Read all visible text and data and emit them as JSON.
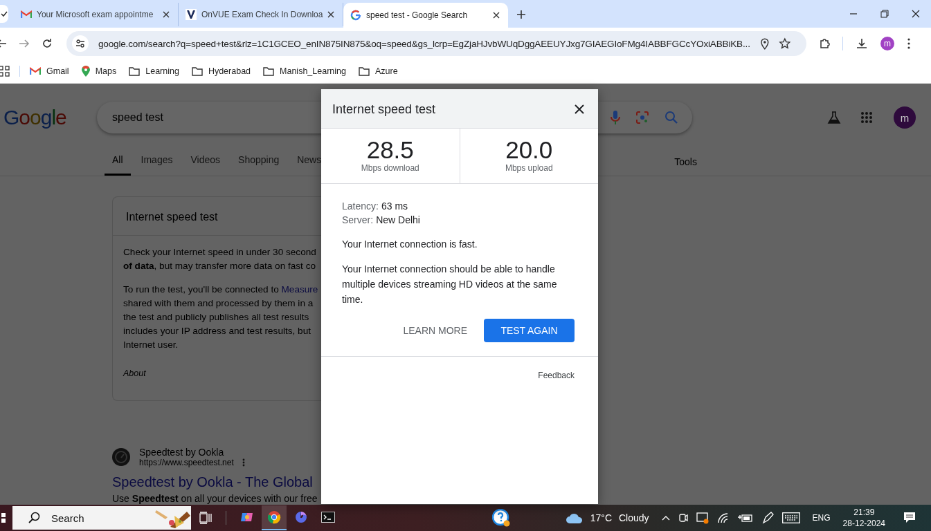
{
  "browser": {
    "tabs": [
      {
        "title": "Your Microsoft exam appointme",
        "kind": "gmail",
        "selected": false
      },
      {
        "title": "OnVUE Exam Check In Downloa",
        "kind": "vue",
        "selected": false
      },
      {
        "title": "speed test - Google Search",
        "kind": "google",
        "selected": true
      }
    ],
    "address": "google.com/search?q=speed+test&rlz=1C1GCEO_enIN875IN875&oq=speed&gs_lcrp=EgZjaHJvbWUqDggAEEUYJxg7GIAEGIoFMg4IABBFGCcYOxiABBiKB...",
    "avatar": "m",
    "bookmarks": [
      {
        "label": "Gmail",
        "kind": "gmail"
      },
      {
        "label": "Maps",
        "kind": "maps"
      },
      {
        "label": "Learning",
        "kind": "folder"
      },
      {
        "label": "Hyderabad",
        "kind": "folder"
      },
      {
        "label": "Manish_Learning",
        "kind": "folder"
      },
      {
        "label": "Azure",
        "kind": "folder"
      }
    ]
  },
  "page": {
    "logo": "Google",
    "query": "speed test",
    "avatar": "m",
    "tabs": [
      {
        "label": "All",
        "selected": true
      },
      {
        "label": "Images",
        "selected": false
      },
      {
        "label": "Videos",
        "selected": false
      },
      {
        "label": "Shopping",
        "selected": false
      },
      {
        "label": "News",
        "selected": false
      }
    ],
    "tools": "Tools",
    "card": {
      "title": "Internet speed test",
      "paragraph_1": [
        "Check your Internet speed in under 30 second",
        "**of data**, but may transfer more data on fast co"
      ],
      "paragraph_2": {
        "first": "To run the test, you'll be connected to ",
        "link": "Measure",
        "rest": [
          "shared with them and processed by them in a",
          "the test and publicly publishes all test results",
          "includes your IP address and test results, but",
          "Internet user."
        ]
      },
      "about": "About"
    },
    "result": {
      "site": "Speedtest by Ookla",
      "url": "https://www.speedtest.net",
      "title": "Speedtest by Ookla - The Global",
      "snippet": "Use **Speedtest** on all your devices with our free"
    }
  },
  "dialog": {
    "title": "Internet speed test",
    "stats": [
      {
        "value": "28.5",
        "label": "Mbps download"
      },
      {
        "value": "20.0",
        "label": "Mbps upload"
      }
    ],
    "details": [
      {
        "label": "Latency:",
        "value": "63 ms"
      },
      {
        "label": "Server:",
        "value": "New Delhi"
      }
    ],
    "status": "Your Internet connection is fast.",
    "description": "Your Internet connection should be able to handle multiple devices streaming HD videos at the same time.",
    "learn_more": "LEARN MORE",
    "test_again": "TEST AGAIN",
    "feedback": "Feedback"
  },
  "taskbar": {
    "search": "Search",
    "apps": [
      {
        "kind": "copilot",
        "selected": false
      },
      {
        "kind": "chrome",
        "selected": true
      },
      {
        "kind": "edge",
        "selected": false
      },
      {
        "kind": "terminal",
        "selected": false
      }
    ],
    "temperature": "17°C",
    "weather": "Cloudy",
    "language": "ENG",
    "time": "21:39",
    "date": "28-12-2024"
  }
}
